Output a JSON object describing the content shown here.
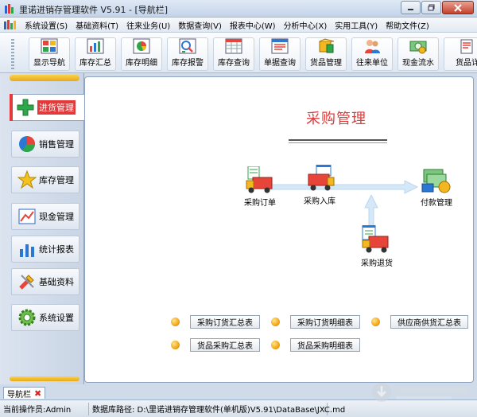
{
  "window": {
    "title": "里诺进销存管理软件 V5.91 - [导航栏]",
    "buttons": [
      "minimize",
      "restore",
      "close"
    ]
  },
  "menu": {
    "items": [
      {
        "label": "系统设置(S)"
      },
      {
        "label": "基础资料(T)"
      },
      {
        "label": "往来业务(U)"
      },
      {
        "label": "数据查询(V)"
      },
      {
        "label": "报表中心(W)"
      },
      {
        "label": "分析中心(X)"
      },
      {
        "label": "实用工具(Y)"
      },
      {
        "label": "帮助文件(Z)"
      }
    ]
  },
  "toolbar": {
    "buttons": [
      {
        "label": "显示导航",
        "icon": "grid-icon"
      },
      {
        "label": "库存汇总",
        "icon": "chart-icon"
      },
      {
        "label": "库存明细",
        "icon": "pie-chart-icon"
      },
      {
        "label": "库存报警",
        "icon": "alarm-icon"
      },
      {
        "label": "库存查询",
        "icon": "table-icon"
      },
      {
        "label": "单据查询",
        "icon": "document-icon"
      },
      {
        "label": "货品管理",
        "icon": "goods-icon"
      },
      {
        "label": "往来单位",
        "icon": "people-icon"
      },
      {
        "label": "现金流水",
        "icon": "money-icon"
      },
      {
        "label": "货品详"
      }
    ]
  },
  "nav": {
    "items": [
      {
        "label": "进货管理",
        "icon": "plus-icon",
        "active": true
      },
      {
        "label": "销售管理",
        "icon": "pie-icon"
      },
      {
        "label": "库存管理",
        "icon": "star-icon"
      },
      {
        "label": "现金管理",
        "icon": "cash-icon"
      },
      {
        "label": "统计报表",
        "icon": "stats-icon"
      },
      {
        "label": "基础资料",
        "icon": "tools-icon"
      },
      {
        "label": "系统设置",
        "icon": "gear-icon"
      }
    ]
  },
  "main": {
    "title": "采购管理",
    "flow": {
      "order": "采购订单",
      "receive": "采购入库",
      "payment": "付款管理",
      "return": "采购退货"
    },
    "reports": [
      {
        "label": "采购订货汇总表"
      },
      {
        "label": "采购订货明细表"
      },
      {
        "label": "供应商供货汇总表"
      },
      {
        "label": "货品采购汇总表"
      },
      {
        "label": "货品采购明细表"
      }
    ]
  },
  "tabs": [
    {
      "label": "导航栏"
    }
  ],
  "status": {
    "operator": "当前操作员:Admin",
    "db_path": "数据库路径: D:\\里诺进销存管理软件(单机版)V5.91\\DataBase\\JXC.md"
  },
  "colors": {
    "accent_red": "#e03a3a",
    "nav_bar_yellow": "#f2b52b",
    "arrow_blue": "#cde3f6"
  }
}
